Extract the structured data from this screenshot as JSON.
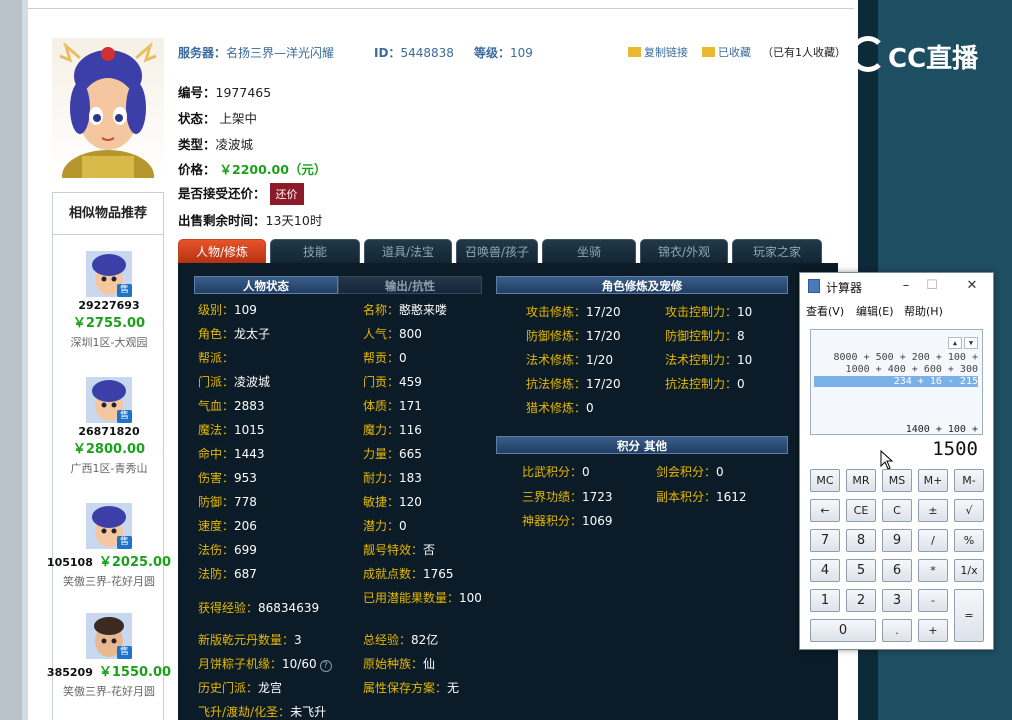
{
  "header": {
    "server_label": "服务器：",
    "server_value": "名扬三界—洋光闪耀",
    "id_label": "ID：",
    "id_value": "5448838",
    "level_label": "等级：",
    "level_value": "109",
    "copy_link": "复制链接",
    "favorited": "已收藏",
    "fav_count": "（已有1人收藏）"
  },
  "info": {
    "number_label": "编号：",
    "number_value": "1977465",
    "status_label": "状态：",
    "status_value": "上架中",
    "type_label": "类型：",
    "type_value": "凌波城",
    "price_label": "价格：",
    "price_value": "￥2200.00（元）",
    "haggle_label": "是否接受还价：",
    "haggle_button": "还价",
    "remaining_label": "出售剩余时间：",
    "remaining_value": "13天10时"
  },
  "sidebar": {
    "title": "相似物品推荐",
    "badge": "售",
    "items": [
      {
        "id": "29227693",
        "price": "￥2755.00",
        "server": "深圳1区-大观园"
      },
      {
        "id": "26871820",
        "price": "￥2800.00",
        "server": "广西1区-青秀山"
      },
      {
        "id": "105108",
        "price": "￥2025.00",
        "server": "笑傲三界-花好月圆"
      },
      {
        "id": "385209",
        "price": "￥1550.00",
        "server": "笑傲三界-花好月圆"
      }
    ]
  },
  "tabs": [
    "人物/修炼",
    "技能",
    "道具/法宝",
    "召唤兽/孩子",
    "坐骑",
    "锦衣/外观",
    "玩家之家"
  ],
  "sections": {
    "char_status": "人物状态",
    "output_resist": "输出/抗性",
    "cultivation": "角色修炼及宠修",
    "points_other": "积分  其他"
  },
  "stats_left": [
    {
      "k": "级别：",
      "v": "109"
    },
    {
      "k": "角色：",
      "v": "龙太子"
    },
    {
      "k": "帮派：",
      "v": ""
    },
    {
      "k": "门派：",
      "v": "凌波城"
    },
    {
      "k": "气血：",
      "v": "2883"
    },
    {
      "k": "魔法：",
      "v": "1015"
    },
    {
      "k": "命中：",
      "v": "1443"
    },
    {
      "k": "伤害：",
      "v": "953"
    },
    {
      "k": "防御：",
      "v": "778"
    },
    {
      "k": "速度：",
      "v": "206"
    },
    {
      "k": "法伤：",
      "v": "699"
    },
    {
      "k": "法防：",
      "v": "687"
    },
    {
      "k": "获得经验：",
      "v": "86834639"
    },
    {
      "k": "新版乾元丹数量：",
      "v": "3"
    },
    {
      "k": "月饼粽子机缘：",
      "v": "10/60"
    },
    {
      "k": "历史门派：",
      "v": "龙宫"
    },
    {
      "k": "飞升/渡劫/化圣：",
      "v": "未飞升"
    }
  ],
  "stats_right": [
    {
      "k": "名称：",
      "v": "憨憨来喽"
    },
    {
      "k": "人气：",
      "v": "800"
    },
    {
      "k": "帮贡：",
      "v": "0"
    },
    {
      "k": "门贡：",
      "v": "459"
    },
    {
      "k": "体质：",
      "v": "171"
    },
    {
      "k": "魔力：",
      "v": "116"
    },
    {
      "k": "力量：",
      "v": "665"
    },
    {
      "k": "耐力：",
      "v": "183"
    },
    {
      "k": "敏捷：",
      "v": "120"
    },
    {
      "k": "潜力：",
      "v": "0"
    },
    {
      "k": "靓号特效：",
      "v": "否"
    },
    {
      "k": "成就点数：",
      "v": "1765"
    },
    {
      "k": "已用潜能果数量：",
      "v": "100"
    },
    {
      "k": "总经验：",
      "v": "82亿"
    },
    {
      "k": "原始种族：",
      "v": "仙"
    },
    {
      "k": "属性保存方案：",
      "v": "无"
    }
  ],
  "cultivation": [
    {
      "k": "攻击修炼：",
      "v": "17/20",
      "k2": "攻击控制力：",
      "v2": "10"
    },
    {
      "k": "防御修炼：",
      "v": "17/20",
      "k2": "防御控制力：",
      "v2": "8"
    },
    {
      "k": "法术修炼：",
      "v": "1/20",
      "k2": "法术控制力：",
      "v2": "10"
    },
    {
      "k": "抗法修炼：",
      "v": "17/20",
      "k2": "抗法控制力：",
      "v2": "0"
    },
    {
      "k": "猎术修炼：",
      "v": "0",
      "k2": "",
      "v2": ""
    }
  ],
  "points": [
    {
      "k": "比武积分：",
      "v": "0",
      "k2": "剑会积分：",
      "v2": "0"
    },
    {
      "k": "三界功绩：",
      "v": "1723",
      "k2": "副本积分：",
      "v2": "1612"
    },
    {
      "k": "神器积分：",
      "v": "1069",
      "k2": "",
      "v2": ""
    }
  ],
  "calculator": {
    "title": "计算器",
    "menu": [
      "查看(V)",
      "编辑(E)",
      "帮助(H)"
    ],
    "history": [
      "8000 + 500 + 200 + 100 +",
      "1000 + 400 + 600 + 300",
      "234 + 16 - 215"
    ],
    "expression": "1400 + 100 +",
    "result": "1500",
    "keys": [
      "MC",
      "MR",
      "MS",
      "M+",
      "M-",
      "←",
      "CE",
      "C",
      "±",
      "√",
      "7",
      "8",
      "9",
      "/",
      "%",
      "4",
      "5",
      "6",
      "*",
      "1/x",
      "1",
      "2",
      "3",
      "-",
      "=",
      "0",
      ".",
      "+"
    ]
  },
  "branding": {
    "logo_text": "CC直播"
  }
}
